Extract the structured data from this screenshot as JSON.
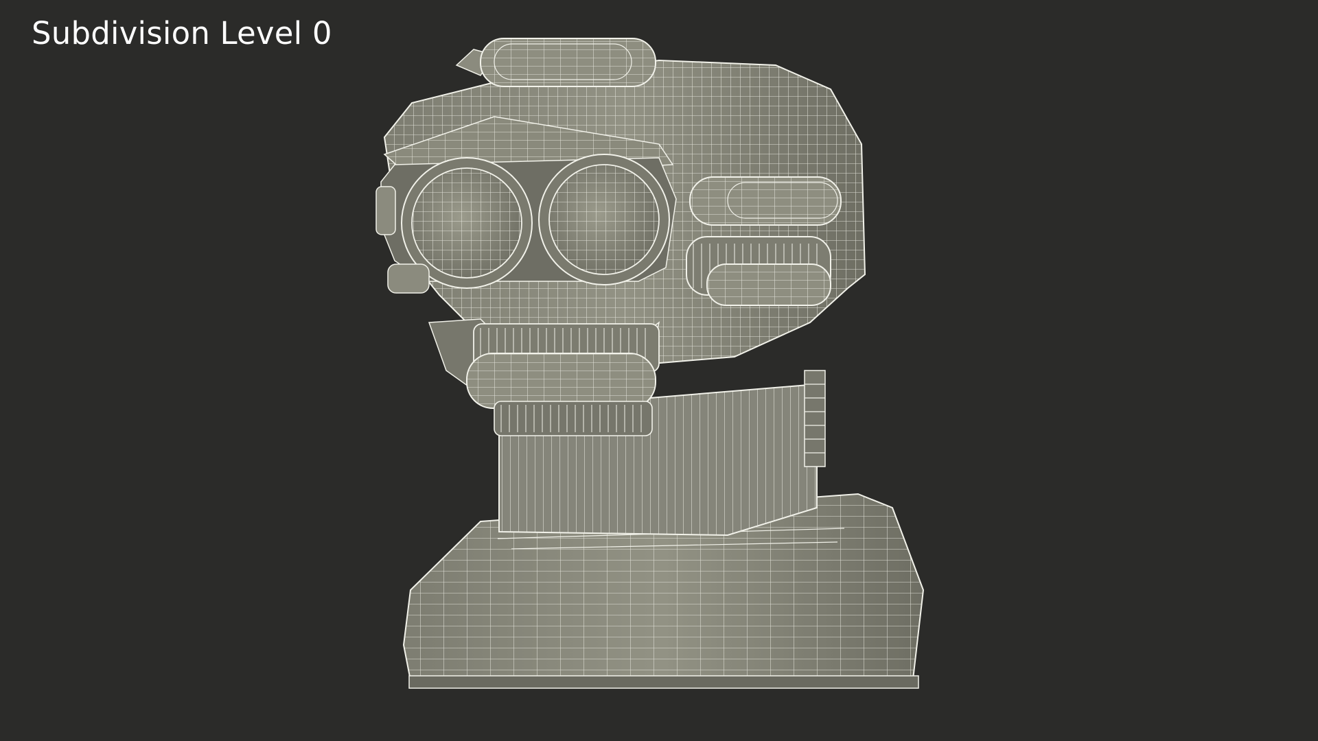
{
  "viewport": {
    "label": "Subdivision Level 0",
    "background_color": "#2b2b29",
    "mesh_fill_color": "#8e8e80",
    "mesh_wire_color": "#f2f2ea"
  },
  "model": {
    "icon": "robot-head-wireframe-model"
  }
}
